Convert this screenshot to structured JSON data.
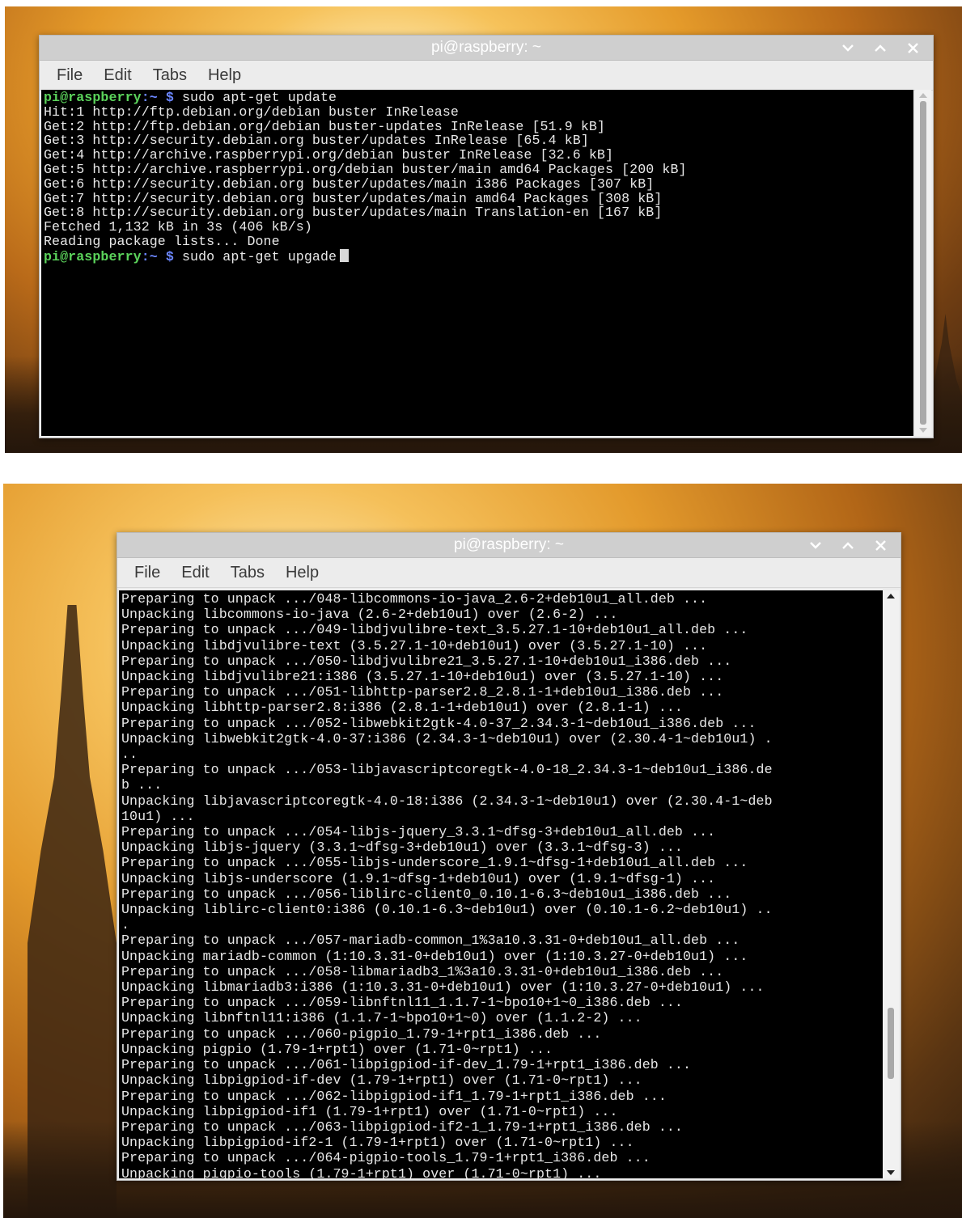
{
  "windows": [
    {
      "title": "pi@raspberry: ~",
      "menu": [
        "File",
        "Edit",
        "Tabs",
        "Help"
      ],
      "lines": [
        {
          "user": "pi@raspberry",
          "path": ":~ $",
          "cmd": " sudo apt-get update"
        },
        {
          "text": "Hit:1 http://ftp.debian.org/debian buster InRelease"
        },
        {
          "text": "Get:2 http://ftp.debian.org/debian buster-updates InRelease [51.9 kB]"
        },
        {
          "text": "Get:3 http://security.debian.org buster/updates InRelease [65.4 kB]"
        },
        {
          "text": "Get:4 http://archive.raspberrypi.org/debian buster InRelease [32.6 kB]"
        },
        {
          "text": "Get:5 http://archive.raspberrypi.org/debian buster/main amd64 Packages [200 kB]"
        },
        {
          "text": "Get:6 http://security.debian.org buster/updates/main i386 Packages [307 kB]"
        },
        {
          "text": "Get:7 http://security.debian.org buster/updates/main amd64 Packages [308 kB]"
        },
        {
          "text": "Get:8 http://security.debian.org buster/updates/main Translation-en [167 kB]"
        },
        {
          "text": "Fetched 1,132 kB in 3s (406 kB/s)"
        },
        {
          "text": "Reading package lists... Done"
        },
        {
          "user": "pi@raspberry",
          "path": ":~ $",
          "cmd": " sudo apt-get upgade",
          "cursor": true
        }
      ]
    },
    {
      "title": "pi@raspberry: ~",
      "menu": [
        "File",
        "Edit",
        "Tabs",
        "Help"
      ],
      "lines": [
        {
          "text": "Preparing to unpack .../048-libcommons-io-java_2.6-2+deb10u1_all.deb ..."
        },
        {
          "text": "Unpacking libcommons-io-java (2.6-2+deb10u1) over (2.6-2) ..."
        },
        {
          "text": "Preparing to unpack .../049-libdjvulibre-text_3.5.27.1-10+deb10u1_all.deb ..."
        },
        {
          "text": "Unpacking libdjvulibre-text (3.5.27.1-10+deb10u1) over (3.5.27.1-10) ..."
        },
        {
          "text": "Preparing to unpack .../050-libdjvulibre21_3.5.27.1-10+deb10u1_i386.deb ..."
        },
        {
          "text": "Unpacking libdjvulibre21:i386 (3.5.27.1-10+deb10u1) over (3.5.27.1-10) ..."
        },
        {
          "text": "Preparing to unpack .../051-libhttp-parser2.8_2.8.1-1+deb10u1_i386.deb ..."
        },
        {
          "text": "Unpacking libhttp-parser2.8:i386 (2.8.1-1+deb10u1) over (2.8.1-1) ..."
        },
        {
          "text": "Preparing to unpack .../052-libwebkit2gtk-4.0-37_2.34.3-1~deb10u1_i386.deb ..."
        },
        {
          "text": "Unpacking libwebkit2gtk-4.0-37:i386 (2.34.3-1~deb10u1) over (2.30.4-1~deb10u1) ."
        },
        {
          "text": ".."
        },
        {
          "text": "Preparing to unpack .../053-libjavascriptcoregtk-4.0-18_2.34.3-1~deb10u1_i386.de"
        },
        {
          "text": "b ..."
        },
        {
          "text": "Unpacking libjavascriptcoregtk-4.0-18:i386 (2.34.3-1~deb10u1) over (2.30.4-1~deb"
        },
        {
          "text": "10u1) ..."
        },
        {
          "text": "Preparing to unpack .../054-libjs-jquery_3.3.1~dfsg-3+deb10u1_all.deb ..."
        },
        {
          "text": "Unpacking libjs-jquery (3.3.1~dfsg-3+deb10u1) over (3.3.1~dfsg-3) ..."
        },
        {
          "text": "Preparing to unpack .../055-libjs-underscore_1.9.1~dfsg-1+deb10u1_all.deb ..."
        },
        {
          "text": "Unpacking libjs-underscore (1.9.1~dfsg-1+deb10u1) over (1.9.1~dfsg-1) ..."
        },
        {
          "text": "Preparing to unpack .../056-liblirc-client0_0.10.1-6.3~deb10u1_i386.deb ..."
        },
        {
          "text": "Unpacking liblirc-client0:i386 (0.10.1-6.3~deb10u1) over (0.10.1-6.2~deb10u1) .."
        },
        {
          "text": "."
        },
        {
          "text": "Preparing to unpack .../057-mariadb-common_1%3a10.3.31-0+deb10u1_all.deb ..."
        },
        {
          "text": "Unpacking mariadb-common (1:10.3.31-0+deb10u1) over (1:10.3.27-0+deb10u1) ..."
        },
        {
          "text": "Preparing to unpack .../058-libmariadb3_1%3a10.3.31-0+deb10u1_i386.deb ..."
        },
        {
          "text": "Unpacking libmariadb3:i386 (1:10.3.31-0+deb10u1) over (1:10.3.27-0+deb10u1) ..."
        },
        {
          "text": "Preparing to unpack .../059-libnftnl11_1.1.7-1~bpo10+1~0_i386.deb ..."
        },
        {
          "text": "Unpacking libnftnl11:i386 (1.1.7-1~bpo10+1~0) over (1.1.2-2) ..."
        },
        {
          "text": "Preparing to unpack .../060-pigpio_1.79-1+rpt1_i386.deb ..."
        },
        {
          "text": "Unpacking pigpio (1.79-1+rpt1) over (1.71-0~rpt1) ..."
        },
        {
          "text": "Preparing to unpack .../061-libpigpiod-if-dev_1.79-1+rpt1_i386.deb ..."
        },
        {
          "text": "Unpacking libpigpiod-if-dev (1.79-1+rpt1) over (1.71-0~rpt1) ..."
        },
        {
          "text": "Preparing to unpack .../062-libpigpiod-if1_1.79-1+rpt1_i386.deb ..."
        },
        {
          "text": "Unpacking libpigpiod-if1 (1.79-1+rpt1) over (1.71-0~rpt1) ..."
        },
        {
          "text": "Preparing to unpack .../063-libpigpiod-if2-1_1.79-1+rpt1_i386.deb ..."
        },
        {
          "text": "Unpacking libpigpiod-if2-1 (1.79-1+rpt1) over (1.71-0~rpt1) ..."
        },
        {
          "text": "Preparing to unpack .../064-pigpio-tools_1.79-1+rpt1_i386.deb ..."
        },
        {
          "text": "Unpacking pigpio-tools (1.79-1+rpt1) over (1.71-0~rpt1) ..."
        }
      ]
    }
  ],
  "icons": {
    "minimize": "chevron-down-icon",
    "maximize": "chevron-up-icon",
    "close": "close-icon"
  },
  "colors": {
    "prompt_user": "#5bd35b",
    "prompt_path": "#6b86ff",
    "terminal_bg": "#000000",
    "terminal_fg": "#e8e8e8"
  }
}
